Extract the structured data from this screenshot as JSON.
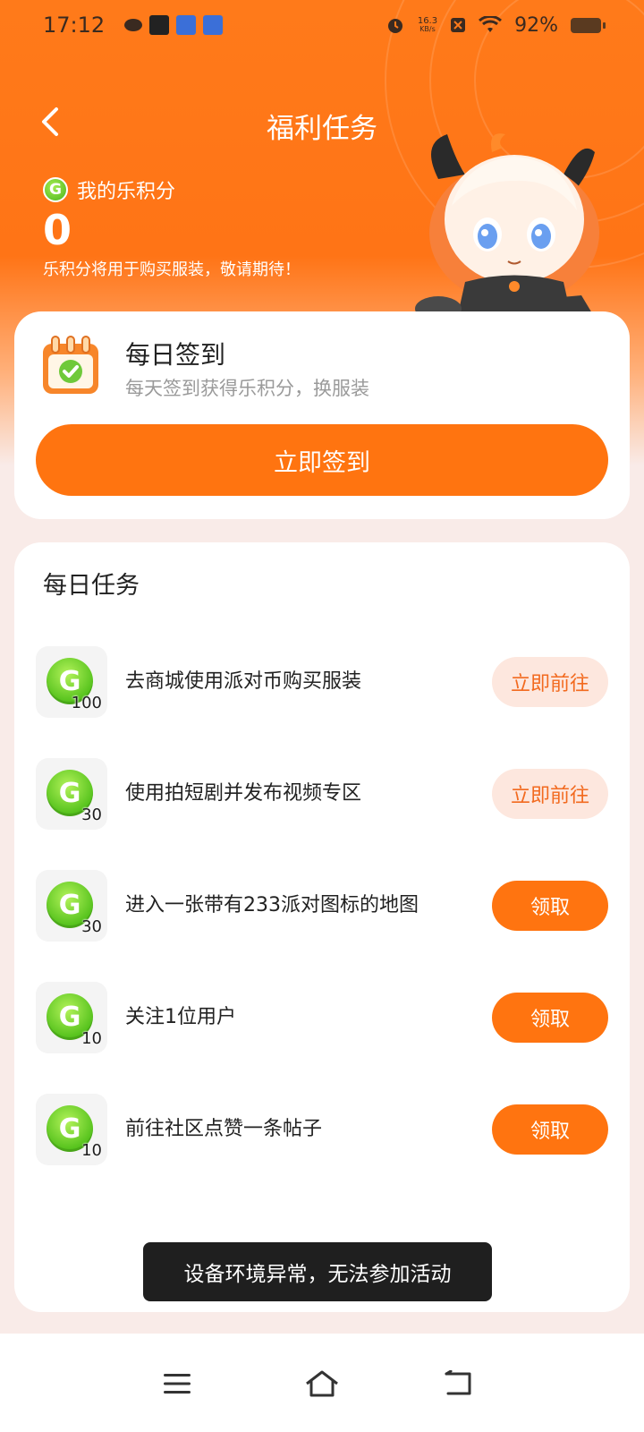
{
  "status_bar": {
    "time": "17:12",
    "net_speed_value": "16.3",
    "net_speed_unit": "KB/s",
    "battery": "92%"
  },
  "header": {
    "title": "福利任务",
    "points_label": "我的乐积分",
    "points_value": "0",
    "points_note": "乐积分将用于购买服装，敬请期待！",
    "coin_letter": "G"
  },
  "signin": {
    "title": "每日签到",
    "subtitle": "每天签到获得乐积分，换服装",
    "button_label": "立即签到"
  },
  "tasks": {
    "title": "每日任务",
    "items": [
      {
        "reward": "100",
        "label": "去商城使用派对币购买服装",
        "action": "立即前往",
        "action_type": "go"
      },
      {
        "reward": "30",
        "label": "使用拍短剧并发布视频专区",
        "action": "立即前往",
        "action_type": "go"
      },
      {
        "reward": "30",
        "label": "进入一张带有233派对图标的地图",
        "action": "领取",
        "action_type": "claim"
      },
      {
        "reward": "10",
        "label": "关注1位用户",
        "action": "领取",
        "action_type": "claim"
      },
      {
        "reward": "10",
        "label": "前往社区点赞一条帖子",
        "action": "领取",
        "action_type": "claim"
      }
    ]
  },
  "toast": "设备环境异常，无法参加活动",
  "colors": {
    "accent": "#ff7410",
    "go_bg": "#fde7de",
    "go_text": "#f26a1f",
    "coin_green": "#55c21c"
  },
  "nav_icons": [
    "menu-icon",
    "home-icon",
    "back-icon"
  ]
}
